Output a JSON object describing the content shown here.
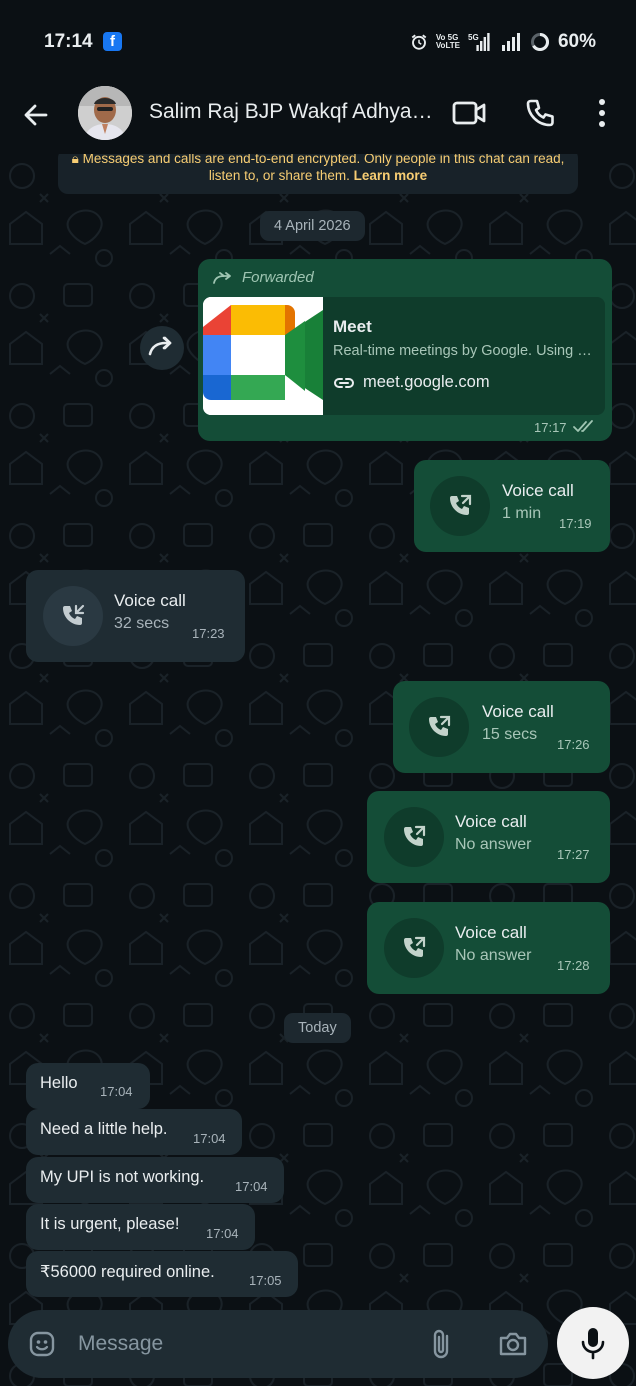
{
  "status_bar": {
    "time": "17:14",
    "notification_icon": "facebook-icon",
    "network_tag_top": "Vo 5G",
    "network_tag_bottom": "VoLTE",
    "signal_label": "5G",
    "battery": "60%"
  },
  "header": {
    "contact_name": "Salim Raj BJP Wakqf Adhyaksh",
    "back_icon": "arrow-left-icon",
    "video_icon": "video-call-icon",
    "call_icon": "phone-icon",
    "menu_icon": "more-vertical-icon"
  },
  "encryption_notice": {
    "text": "Messages and calls are end-to-end encrypted. Only people in this chat can read, listen to, or share them.",
    "link": "Learn more"
  },
  "date_dividers": [
    "4 April 2026",
    "Today"
  ],
  "messages": [
    {
      "type": "link",
      "direction": "out",
      "forwarded_label": "Forwarded",
      "title": "Meet",
      "description": "Real-time meetings by Google. Using Google Meet",
      "url": "meet.google.com",
      "time": "17:17",
      "status": "read"
    },
    {
      "type": "call",
      "direction": "out",
      "title": "Voice call",
      "detail": "1 min",
      "time": "17:19"
    },
    {
      "type": "call",
      "direction": "in",
      "title": "Voice call",
      "detail": "32 secs",
      "time": "17:23"
    },
    {
      "type": "call",
      "direction": "out",
      "title": "Voice call",
      "detail": "15 secs",
      "time": "17:26"
    },
    {
      "type": "call",
      "direction": "out",
      "title": "Voice call",
      "detail": "No answer",
      "time": "17:27"
    },
    {
      "type": "call",
      "direction": "out",
      "title": "Voice call",
      "detail": "No answer",
      "time": "17:28"
    },
    {
      "type": "text",
      "direction": "in",
      "text": "Hello",
      "time": "17:04"
    },
    {
      "type": "text",
      "direction": "in",
      "text": "Need a little help.",
      "time": "17:04"
    },
    {
      "type": "text",
      "direction": "in",
      "text": "My UPI is not working.",
      "time": "17:04"
    },
    {
      "type": "text",
      "direction": "in",
      "text": "It is urgent, please!",
      "time": "17:04"
    },
    {
      "type": "text",
      "direction": "in",
      "text": "₹56000 required online.",
      "time": "17:05"
    }
  ],
  "input_bar": {
    "placeholder": "Message",
    "emoji_icon": "emoji-icon",
    "attach_icon": "paperclip-icon",
    "camera_icon": "camera-icon",
    "mic_icon": "microphone-icon"
  },
  "colors": {
    "background": "#0b1014",
    "outgoing_bubble": "#144d37",
    "incoming_bubble": "#1f2c33",
    "encryption_text": "#f7cd73"
  }
}
